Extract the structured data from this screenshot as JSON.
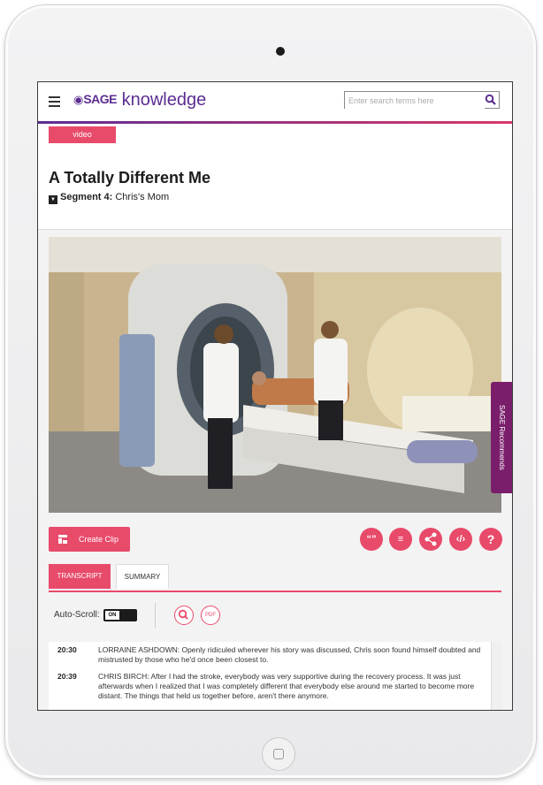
{
  "header": {
    "logo_brand": "SAGE",
    "logo_product": "knowledge",
    "search_placeholder": "Enter search terms here"
  },
  "content_type_badge": "video",
  "video": {
    "title": "A Totally Different Me",
    "segment_label": "Segment 4:",
    "segment_name": "Chris's Mom"
  },
  "recommends_tab": "SAGE Recommends",
  "actions": {
    "create_clip": "Create Clip",
    "icons": [
      "quote-icon",
      "playlist-icon",
      "share-icon",
      "embed-icon",
      "help-icon"
    ],
    "help_glyph": "?"
  },
  "tabs": [
    {
      "label": "TRANSCRIPT",
      "active": true
    },
    {
      "label": "SUMMARY",
      "active": false
    }
  ],
  "autoscroll": {
    "label": "Auto-Scroll:",
    "state": "ON"
  },
  "pdf_label": "PDF",
  "transcript": [
    {
      "time": "20:30",
      "text": "LORRAINE ASHDOWN: Openly ridiculed wherever his story was discussed, Chris soon found himself doubted and mistrusted by those who he'd once been closest to."
    },
    {
      "time": "20:39",
      "text": "CHRIS BIRCH: After I had the stroke, everybody was very supportive during the recovery process. It was just afterwards when I realized that I was completely different that everybody else around me started to become more distant. The things that held us together before, aren't there anymore."
    }
  ],
  "colors": {
    "accent": "#e84a6a",
    "brand_purple": "#5c2d91",
    "recommends": "#7a1e6b"
  }
}
